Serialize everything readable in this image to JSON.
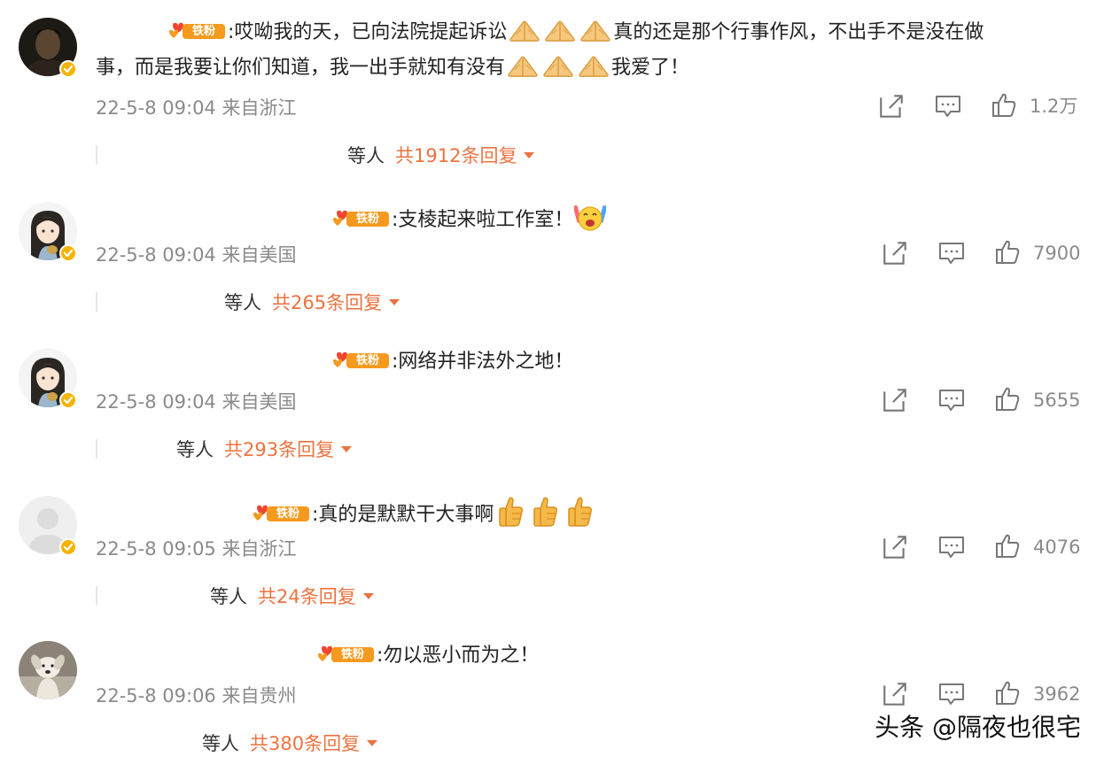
{
  "fan_badge_label": "铁粉",
  "comments": [
    {
      "avatar": "dark-portrait",
      "line1": ":哎呦我的天，已向法院提起诉讼",
      "line1_tail": "真的还是那个行事作风，不出手不是没在做",
      "line2": "事，而是我要让你们知道，我一出手就知有没有",
      "line2_tail": "我爱了！",
      "emoji": "pray-hands-icon",
      "meta": "22-5-8 09:04 来自浙江",
      "likes": "1.2万",
      "reply_prefix": "等人",
      "reply_count": "共1912条回复"
    },
    {
      "avatar": "cartoon-girl",
      "line1": ":支棱起来啦工作室！",
      "emoji": "cheer-face-icon",
      "meta": "22-5-8 09:04 来自美国",
      "likes": "7900",
      "reply_prefix": "等人",
      "reply_count": "共265条回复"
    },
    {
      "avatar": "cartoon-girl",
      "line1": ":网络并非法外之地！",
      "meta": "22-5-8 09:04 来自美国",
      "likes": "5655",
      "reply_prefix": "等人",
      "reply_count": "共293条回复"
    },
    {
      "avatar": "default-gray",
      "line1": ":真的是默默干大事啊",
      "emoji": "thumbs-up-icon",
      "meta": "22-5-8 09:05 来自浙江",
      "likes": "4076",
      "reply_prefix": "等人",
      "reply_count": "共24条回复"
    },
    {
      "avatar": "dog-photo",
      "line1": ":勿以恶小而为之！",
      "meta": "22-5-8 09:06 来自贵州",
      "likes": "3962",
      "reply_prefix": "等人",
      "reply_count": "共380条回复"
    }
  ],
  "watermark": "头条 @隔夜也很宅",
  "colors": {
    "reply_accent": "#eb7340",
    "fan_badge": "#f59a1e",
    "verified_badge": "#f5b400",
    "meta_gray": "#8a8a8a"
  }
}
